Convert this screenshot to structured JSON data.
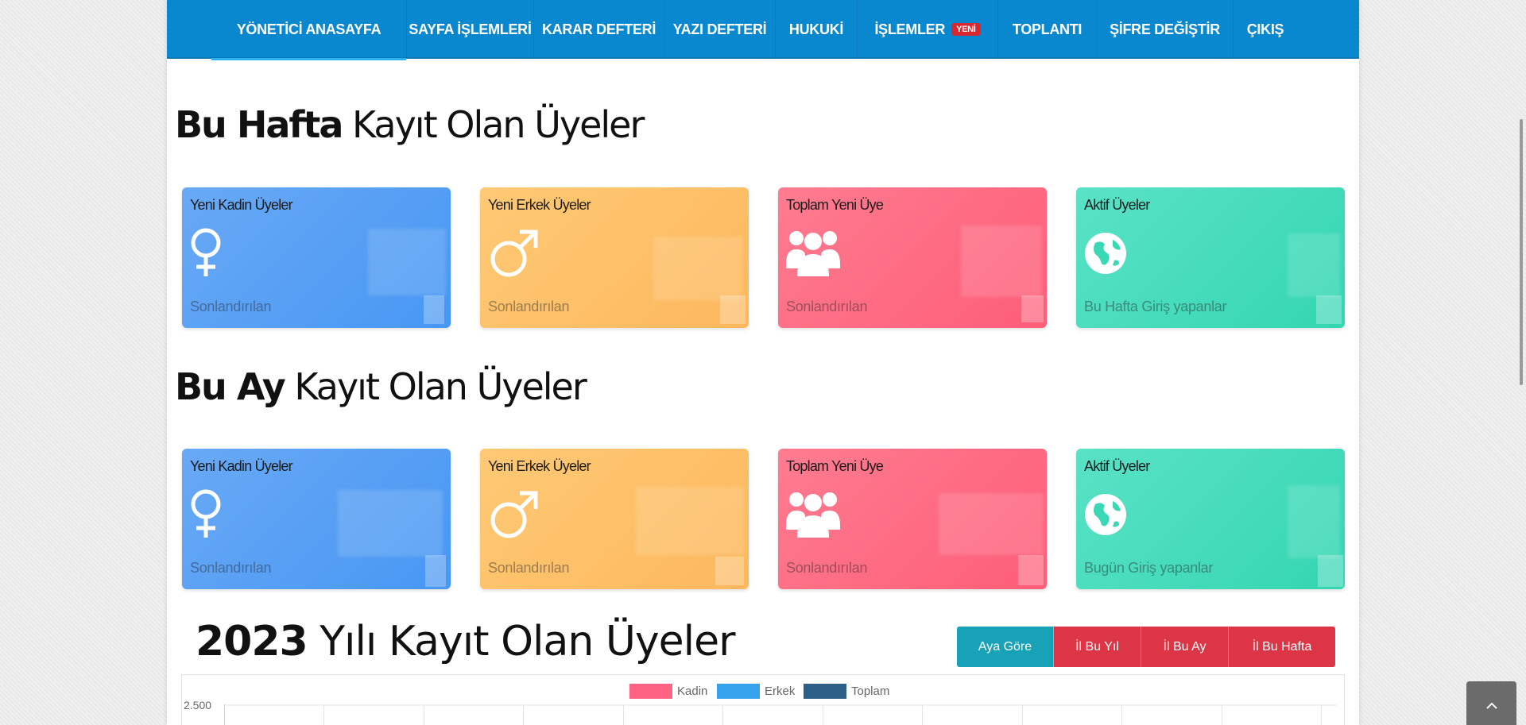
{
  "nav": {
    "items": [
      {
        "label": "YÖNETİCİ ANASAYFA"
      },
      {
        "label": "SAYFA İŞLEMLERİ"
      },
      {
        "label": "KARAR DEFTERİ"
      },
      {
        "label": "YAZI DEFTERİ"
      },
      {
        "label": "HUKUKİ"
      },
      {
        "label": "İŞLEMLER",
        "badge": "YENİ"
      },
      {
        "label": "TOPLANTI"
      },
      {
        "label": "ŞİFRE DEĞİŞTİR"
      },
      {
        "label": "ÇIKIŞ"
      }
    ]
  },
  "week": {
    "title_bold": "Bu Hafta",
    "title_light": "Kayıt Olan Üyeler",
    "cards": [
      {
        "title": "Yeni Kadin Üyeler",
        "footer": "Sonlandırılan",
        "icon": "female-icon",
        "color": "#4a98f3"
      },
      {
        "title": "Yeni Erkek Üyeler",
        "footer": "Sonlandırılan",
        "icon": "male-icon",
        "color": "#fdbb62"
      },
      {
        "title": "Toplam Yeni Üye",
        "footer": "Sonlandırılan",
        "icon": "users-icon",
        "color": "#fd6179"
      },
      {
        "title": "Aktif Üyeler",
        "footer": "Bu Hafta Giriş yapanlar",
        "icon": "globe-icon",
        "color": "#3ad8b5"
      }
    ]
  },
  "month": {
    "title_bold": "Bu Ay",
    "title_light": "Kayıt Olan Üyeler",
    "cards": [
      {
        "title": "Yeni Kadin Üyeler",
        "footer": "Sonlandırılan",
        "icon": "female-icon",
        "color": "#4a98f3"
      },
      {
        "title": "Yeni Erkek Üyeler",
        "footer": "Sonlandırılan",
        "icon": "male-icon",
        "color": "#fdbb62"
      },
      {
        "title": "Toplam Yeni Üye",
        "footer": "Sonlandırılan",
        "icon": "users-icon",
        "color": "#fd6179"
      },
      {
        "title": "Aktif Üyeler",
        "footer": "Bugün Giriş yapanlar",
        "icon": "globe-icon",
        "color": "#3ad8b5"
      }
    ]
  },
  "year": {
    "title_bold": "2023",
    "title_light": "Yılı Kayıt Olan Üyeler",
    "buttons": [
      {
        "label": "Aya Göre"
      },
      {
        "label": "İl Bu Yıl"
      },
      {
        "label": "İl Bu Ay"
      },
      {
        "label": "İl Bu Hafta"
      }
    ]
  },
  "chart_data": {
    "type": "bar",
    "series": [
      {
        "name": "Kadin",
        "color": "#ff6384"
      },
      {
        "name": "Erkek",
        "color": "#36a2eb"
      },
      {
        "name": "Toplam",
        "color": "#2c5f85"
      }
    ],
    "y_ticks": [
      "2.500"
    ]
  },
  "scroll_top_icon": "chevron-up-icon"
}
